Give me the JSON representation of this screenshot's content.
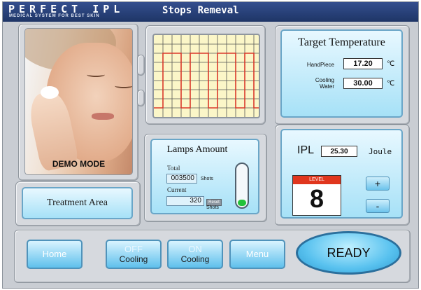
{
  "header": {
    "brand": "PERFECT IPL",
    "brand_sub": "MEDICAL SYSTEM FOR BEST SKIN",
    "title": "Stops Remeval"
  },
  "photo": {
    "label": "DEMO MODE"
  },
  "treatment": {
    "label": "Treatment Area"
  },
  "lamps": {
    "title": "Lamps Amount",
    "total_label": "Total",
    "total_value": "003500",
    "total_unit": "Shots",
    "current_label": "Current",
    "current_value": "320",
    "reset_label": "Reset",
    "current_unit": "Shots",
    "level_fraction": 0.15
  },
  "temperature": {
    "title": "Target Temperature",
    "handpiece_label": "HandPiece",
    "handpiece_value": "17.20",
    "cooling_label_1": "Cooling",
    "cooling_label_2": "Water",
    "cooling_value": "30.00",
    "unit": "℃"
  },
  "ipl": {
    "label": "IPL",
    "value": "25.30",
    "unit": "Joule",
    "level_label": "LEVEL",
    "level_value": "8",
    "plus": "+",
    "minus": "-"
  },
  "bottom": {
    "home": "Home",
    "off_line1": "OFF",
    "off_line2": "Cooling",
    "on_line1": "ON",
    "on_line2": "Cooling",
    "menu": "Menu",
    "ready": "READY"
  },
  "colors": {
    "header": "#2a437c",
    "panel": "#d6d9de",
    "button": "#5fc0ec",
    "level": "#e0361e",
    "graph_line": "#d9382a",
    "graph_bg": "#fbf6c8"
  }
}
